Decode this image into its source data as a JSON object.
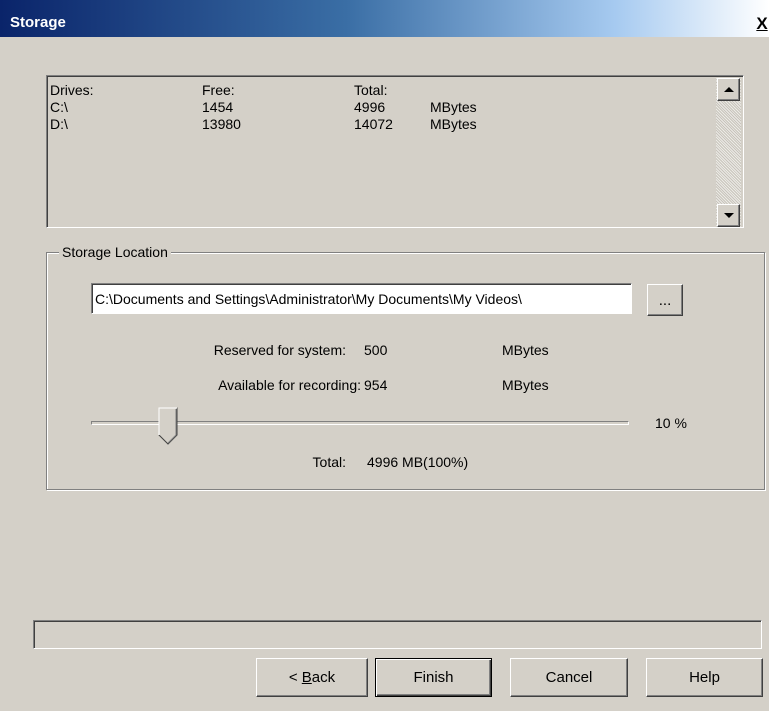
{
  "window": {
    "title": "Storage",
    "close_label": "X"
  },
  "drives": {
    "headers": {
      "drive": "Drives:",
      "free": "Free:",
      "total": "Total:"
    },
    "rows": [
      {
        "drive": "C:\\",
        "free": "1454",
        "total": "4996",
        "unit": "MBytes"
      },
      {
        "drive": "D:\\",
        "free": "13980",
        "total": "14072",
        "unit": "MBytes"
      }
    ]
  },
  "storage_location": {
    "group_label": "Storage Location",
    "path": "C:\\Documents and Settings\\Administrator\\My Documents\\My Videos\\",
    "browse_label": "...",
    "reserved": {
      "label": "Reserved for system:",
      "value": "500",
      "unit": "MBytes"
    },
    "available": {
      "label": "Available for recording:",
      "value": "954",
      "unit": "MBytes"
    },
    "slider": {
      "percent_label": "10 %",
      "value_fraction": 0.1
    },
    "total": {
      "label": "Total:",
      "value": "4996 MB(100%)"
    }
  },
  "buttons": {
    "back": {
      "underlined": "B",
      "rest": "ack",
      "prefix": "< "
    },
    "finish": "Finish",
    "cancel": "Cancel",
    "help": "Help"
  },
  "colors": {
    "face": "#d4d0c8",
    "title_start": "#0a246a",
    "title_end": "#a6caf0"
  }
}
